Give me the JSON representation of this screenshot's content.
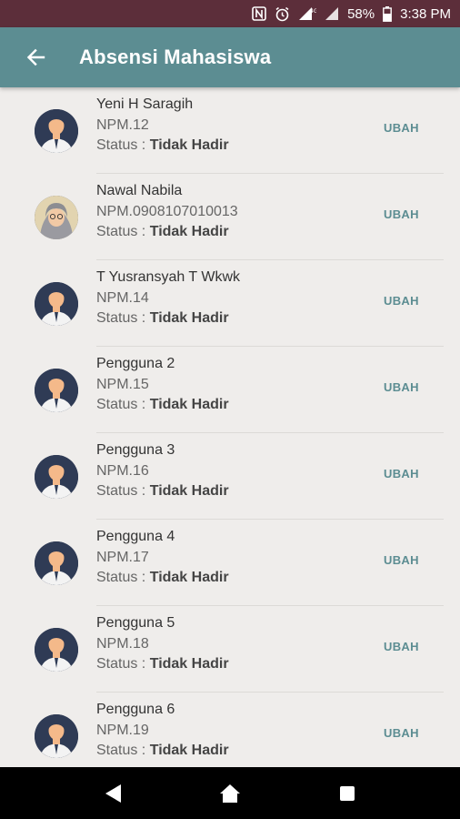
{
  "statusbar": {
    "battery": "58%",
    "time": "3:38 PM",
    "network": "4G"
  },
  "appbar": {
    "title": "Absensi Mahasiswa",
    "back_icon": "arrow-left-icon"
  },
  "list": {
    "status_label": "Status : ",
    "action_label": "UBAH",
    "items": [
      {
        "name": "Yeni H Saragih",
        "npm": "NPM.12",
        "status": "Tidak Hadir",
        "avatar": "default"
      },
      {
        "name": "Nawal Nabila",
        "npm": "NPM.0908107010013",
        "status": "Tidak Hadir",
        "avatar": "photo"
      },
      {
        "name": "T Yusransyah T Wkwk",
        "npm": "NPM.14",
        "status": "Tidak Hadir",
        "avatar": "default"
      },
      {
        "name": "Pengguna 2",
        "npm": "NPM.15",
        "status": "Tidak Hadir",
        "avatar": "default"
      },
      {
        "name": "Pengguna 3",
        "npm": "NPM.16",
        "status": "Tidak Hadir",
        "avatar": "default"
      },
      {
        "name": "Pengguna 4",
        "npm": "NPM.17",
        "status": "Tidak Hadir",
        "avatar": "default"
      },
      {
        "name": "Pengguna 5",
        "npm": "NPM.18",
        "status": "Tidak Hadir",
        "avatar": "default"
      },
      {
        "name": "Pengguna 6",
        "npm": "NPM.19",
        "status": "Tidak Hadir",
        "avatar": "default"
      }
    ]
  },
  "colors": {
    "statusbar": "#5c2e3a",
    "appbar": "#5c8d92",
    "background": "#efedeb",
    "accent": "#5c8d92"
  }
}
